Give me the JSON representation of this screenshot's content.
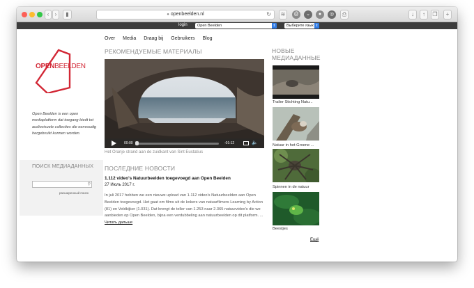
{
  "browser": {
    "url": "openbeelden.nl"
  },
  "topbar": {
    "login": "login",
    "site_select": "Open Beelden",
    "language_select": "Выберите язык"
  },
  "nav": [
    "Over",
    "Media",
    "Draag bij",
    "Gebruikers",
    "Blog"
  ],
  "logo": {
    "text_open": "OPEN",
    "text_beelden": "BEELDEN"
  },
  "tagline": "Open Beelden is een open mediaplatform dat toegang biedt tot audiovisuele collecties die eenvoudig hergebruikt kunnen worden.",
  "search": {
    "title": "ПОИСК МЕДИАДАННЫХ",
    "value": "",
    "advanced": "расширенный поиск"
  },
  "featured": {
    "heading": "РЕКОМЕНДУЕМЫЕ МАТЕРИАЛЫ",
    "time_elapsed": "00:00",
    "time_remaining": "-01:12",
    "caption": "Het Oranje strand aan de zuidkant van Sint Eustatius"
  },
  "news": {
    "heading": "ПОСЛЕДНИЕ НОВОСТИ",
    "title": "1.112 video's Natuurbeelden toegevoegd aan Open Beelden",
    "date": "27 Июль 2017 г.",
    "body": "In juli 2017 hebben we een nieuwe upload van 1.112 video's Natuurbeelden aan Open Beelden toegevoegd. Het gaat om films uit de kokers van natuurfilmers Learning by Action (81) en Veldkijker (1.031). Dat brengt de teller van 1.253 naar 2.365 natuurvideo's die we aanbieden op Open Beelden, bijna een verdubbeling aan natuurbeelden op dit platform. ...",
    "read_more": "Читать дальше"
  },
  "new_media": {
    "heading": "НОВЫЕ МЕДИАДАННЫЕ",
    "items": [
      {
        "caption": "Trailer Stichting Natu..."
      },
      {
        "caption": "Natuur in het Groene ..."
      },
      {
        "caption": "Spinnen in de natuur"
      },
      {
        "caption": "Beestjes"
      }
    ],
    "more": "Ещё"
  }
}
